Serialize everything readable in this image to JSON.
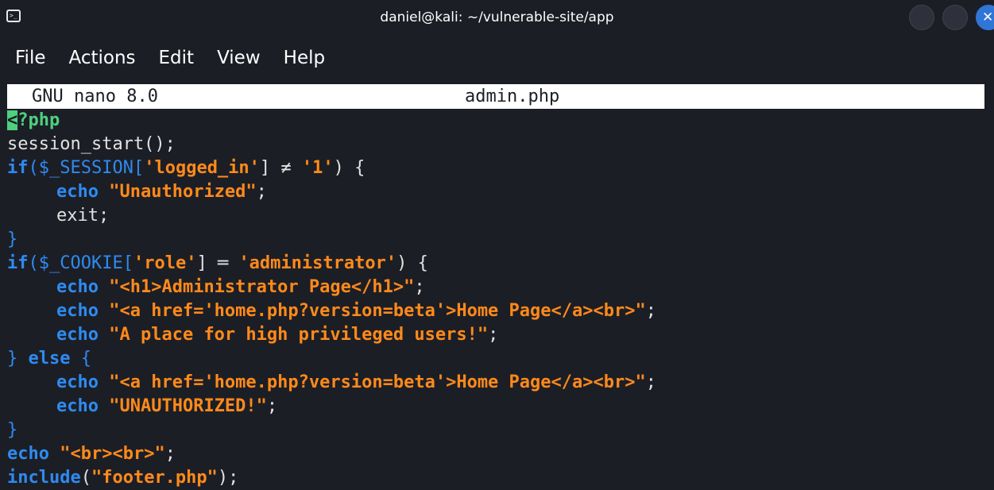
{
  "window": {
    "title": "daniel@kali: ~/vulnerable-site/app"
  },
  "menu": {
    "items": [
      "File",
      "Actions",
      "Edit",
      "View",
      "Help"
    ]
  },
  "nano": {
    "version": "GNU nano 8.0",
    "filename": "admin.php"
  },
  "code": {
    "l1_cursor": "<",
    "l1_rest": "?php",
    "l2": "session_start();",
    "l3_if": "if",
    "l3_open": "(",
    "l3_var": "$_SESSION",
    "l3_br1": "[",
    "l3_key": "'logged_in'",
    "l3_op": "] ≠ ",
    "l3_val": "'1'",
    "l3_close": ") {",
    "l4_echo": "echo",
    "l4_str": "\"Unauthorized\"",
    "l4_end": ";",
    "l5": "exit;",
    "l6": "}",
    "l7_if": "if",
    "l7_open": "(",
    "l7_var": "$_COOKIE",
    "l7_br1": "[",
    "l7_key": "'role'",
    "l7_op": "] ═ ",
    "l7_val": "'administrator'",
    "l7_close": ") {",
    "l8_echo": "echo",
    "l8_str": "\"<h1>Administrator Page</h1>\"",
    "l8_end": ";",
    "l9_echo": "echo",
    "l9_str": "\"<a href='home.php?version=beta'>Home Page</a><br>\"",
    "l9_end": ";",
    "l10_echo": "echo",
    "l10_str": "\"A place for high privileged users!\"",
    "l10_end": ";",
    "l11_open": "} ",
    "l11_else": "else",
    "l11_close": " {",
    "l12_echo": "echo",
    "l12_str": "\"<a href='home.php?version=beta'>Home Page</a><br>\"",
    "l12_end": ";",
    "l13_echo": "echo",
    "l13_str": "\"UNAUTHORIZED!\"",
    "l13_end": ";",
    "l14": "}",
    "l15_echo": "echo",
    "l15_str": "\"<br><br>\"",
    "l15_end": ";",
    "l16_fn": "include",
    "l16_open": "(",
    "l16_str": "\"footer.php\"",
    "l16_end": ");"
  },
  "colors": {
    "background": "#1c1e26",
    "keyword": "#2e8bf0",
    "string": "#ff8a1a",
    "php_tag": "#4ed07e",
    "text": "#e2e2e2"
  }
}
